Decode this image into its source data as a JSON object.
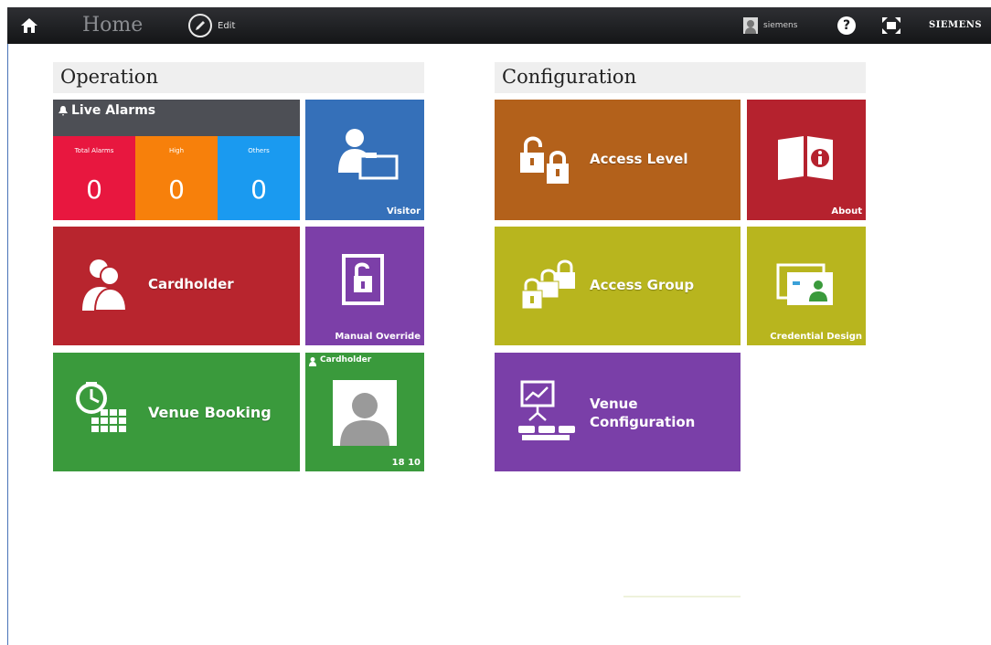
{
  "topbar": {
    "home_title": "Home",
    "edit_label": "Edit",
    "user_name": "siemens",
    "help_label": "?",
    "brand": "SIEMENS"
  },
  "sections": {
    "operation": "Operation",
    "configuration": "Configuration"
  },
  "live_alarms": {
    "title": "Live Alarms",
    "cells": [
      {
        "label": "Total Alarms",
        "value": "0",
        "color": "#e8173f"
      },
      {
        "label": "High",
        "value": "0",
        "color": "#f7800b"
      },
      {
        "label": "Others",
        "value": "0",
        "color": "#1a9af0"
      }
    ]
  },
  "tiles": {
    "visitor": "Visitor",
    "cardholder": "Cardholder",
    "manual_override": "Manual Override",
    "venue_booking": "Venue Booking",
    "cardholder_small_title": "Cardholder",
    "cardholder_small_id": "18 10",
    "access_level": "Access Level",
    "about": "About",
    "access_group": "Access Group",
    "credential_design": "Credential Design",
    "venue_configuration_line1": "Venue",
    "venue_configuration_line2": "Configuration"
  },
  "colors": {
    "visitor": "#3570b9",
    "cardholder": "#b8252e",
    "manual_override": "#7c3fa8",
    "venue_booking": "#3a9a3c",
    "cardholder_small": "#3a9a3c",
    "access_level": "#b3611b",
    "about": "#b5222e",
    "access_group": "#b8b51e",
    "credential_design": "#b8b51e",
    "venue_configuration": "#7a3fa8"
  }
}
